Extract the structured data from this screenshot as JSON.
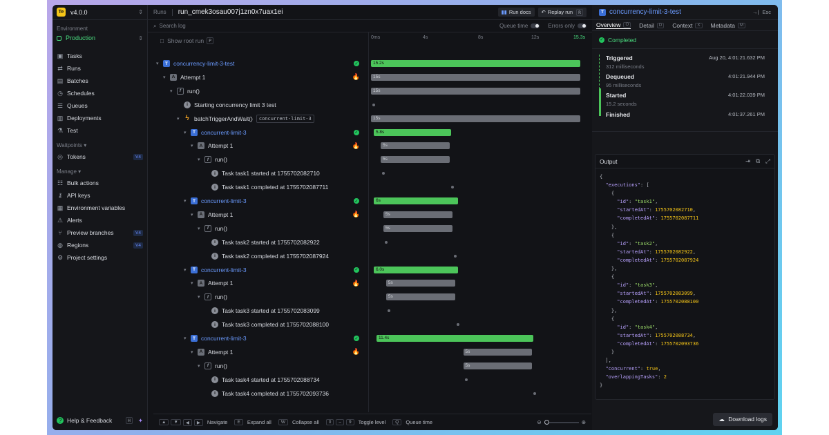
{
  "app": {
    "version": "v4.0.0",
    "logo": "Te"
  },
  "sidebar": {
    "env_label": "Environment",
    "env_value": "Production",
    "items": [
      {
        "label": "Tasks",
        "icon": "tasks-icon",
        "glyph": "▣"
      },
      {
        "label": "Runs",
        "icon": "runs-icon",
        "glyph": "⇄"
      },
      {
        "label": "Batches",
        "icon": "batches-icon",
        "glyph": "▤"
      },
      {
        "label": "Schedules",
        "icon": "schedules-icon",
        "glyph": "◷"
      },
      {
        "label": "Queues",
        "icon": "queues-icon",
        "glyph": "☰"
      },
      {
        "label": "Deployments",
        "icon": "deployments-icon",
        "glyph": "▥"
      },
      {
        "label": "Test",
        "icon": "test-icon",
        "glyph": "⚗"
      }
    ],
    "waitpoints_label": "Waitpoints ▾",
    "waitpoints": [
      {
        "label": "Tokens",
        "badge": "V4",
        "glyph": "◎"
      }
    ],
    "manage_label": "Manage ▾",
    "manage": [
      {
        "label": "Bulk actions",
        "badge": "",
        "glyph": "☷"
      },
      {
        "label": "API keys",
        "badge": "",
        "glyph": "⚷"
      },
      {
        "label": "Environment variables",
        "badge": "",
        "glyph": "▦"
      },
      {
        "label": "Alerts",
        "badge": "",
        "glyph": "⚠"
      },
      {
        "label": "Preview branches",
        "badge": "V4",
        "glyph": "⑂"
      },
      {
        "label": "Regions",
        "badge": "V4",
        "glyph": "◍"
      },
      {
        "label": "Project settings",
        "badge": "",
        "glyph": "⚙"
      }
    ],
    "help": "Help & Feedback",
    "help_kbd": "H"
  },
  "topbar": {
    "crumb": "Runs",
    "run_id": "run_cmek3osau007j1zn0x7uax1ei",
    "docs": "Run docs",
    "replay": "Replay run",
    "replay_kbd": "R"
  },
  "search": {
    "placeholder": "Search log",
    "queue_time": "Queue time",
    "errors_only": "Errors only"
  },
  "tree_header": {
    "show_root": "Show root run",
    "kbd": "P"
  },
  "ticks": [
    {
      "label": "0ms"
    },
    {
      "label": "4s"
    },
    {
      "label": "8s"
    },
    {
      "label": "12s"
    },
    {
      "label": "15.3s"
    }
  ],
  "rows": [
    {
      "depth": 0,
      "caret": "▾",
      "icon": "t",
      "label": "concurrency-limit-3-test",
      "blue": true,
      "status": "ok",
      "bar": {
        "kind": "g",
        "start": 0,
        "end": 15.2,
        "label": "15.2s"
      }
    },
    {
      "depth": 1,
      "caret": "▾",
      "icon": "a",
      "label": "Attempt 1",
      "status": "fire",
      "bar": {
        "kind": "s",
        "start": 0,
        "end": 15.2,
        "label": "15s"
      }
    },
    {
      "depth": 2,
      "caret": "▾",
      "icon": "f",
      "label": "run()",
      "bar": {
        "kind": "s",
        "start": 0,
        "end": 15.2,
        "label": "15s"
      }
    },
    {
      "depth": 3,
      "caret": "",
      "icon": "i",
      "label": "Starting concurrency limit 3 test",
      "dot": 0.1
    },
    {
      "depth": 3,
      "caret": "▾",
      "icon": "b",
      "label": "batchTriggerAndWait()",
      "tag": "concurrent-limit-3",
      "bar": {
        "kind": "s",
        "start": 0,
        "end": 15.2,
        "label": "15s"
      }
    },
    {
      "depth": 4,
      "caret": "▾",
      "icon": "t",
      "label": "concurrent-limit-3",
      "blue": true,
      "status": "ok",
      "bar": {
        "kind": "g",
        "start": 0.2,
        "end": 5.8,
        "label": "5.8s"
      }
    },
    {
      "depth": 5,
      "caret": "▾",
      "icon": "a",
      "label": "Attempt 1",
      "status": "fire",
      "bar": {
        "kind": "s",
        "start": 0.7,
        "end": 5.7,
        "label": "5s"
      }
    },
    {
      "depth": 6,
      "caret": "▾",
      "icon": "f",
      "label": "run()",
      "bar": {
        "kind": "s",
        "start": 0.7,
        "end": 5.7,
        "label": "5s"
      }
    },
    {
      "depth": 7,
      "caret": "",
      "icon": "i",
      "label": "Task task1 started at 1755702082710",
      "dot": 0.8
    },
    {
      "depth": 7,
      "caret": "",
      "icon": "i",
      "label": "Task task1 completed at 1755702087711",
      "dot": 5.8
    },
    {
      "depth": 4,
      "caret": "▾",
      "icon": "t",
      "label": "concurrent-limit-3",
      "blue": true,
      "status": "ok",
      "bar": {
        "kind": "g",
        "start": 0.2,
        "end": 6.3,
        "label": "6s"
      }
    },
    {
      "depth": 5,
      "caret": "▾",
      "icon": "a",
      "label": "Attempt 1",
      "status": "fire",
      "bar": {
        "kind": "s",
        "start": 0.9,
        "end": 5.9,
        "label": "5s"
      }
    },
    {
      "depth": 6,
      "caret": "▾",
      "icon": "f",
      "label": "run()",
      "bar": {
        "kind": "s",
        "start": 0.9,
        "end": 5.9,
        "label": "5s"
      }
    },
    {
      "depth": 7,
      "caret": "",
      "icon": "i",
      "label": "Task task2 started at 1755702082922",
      "dot": 1.0
    },
    {
      "depth": 7,
      "caret": "",
      "icon": "i",
      "label": "Task task2 completed at 1755702087924",
      "dot": 6.0
    },
    {
      "depth": 4,
      "caret": "▾",
      "icon": "t",
      "label": "concurrent-limit-3",
      "blue": true,
      "status": "ok",
      "bar": {
        "kind": "g",
        "start": 0.2,
        "end": 6.3,
        "label": "6.0s"
      }
    },
    {
      "depth": 5,
      "caret": "▾",
      "icon": "a",
      "label": "Attempt 1",
      "status": "fire",
      "bar": {
        "kind": "s",
        "start": 1.1,
        "end": 6.1,
        "label": "5s"
      }
    },
    {
      "depth": 6,
      "caret": "▾",
      "icon": "f",
      "label": "run()",
      "bar": {
        "kind": "s",
        "start": 1.1,
        "end": 6.1,
        "label": "5s"
      }
    },
    {
      "depth": 7,
      "caret": "",
      "icon": "i",
      "label": "Task task3 started at 1755702083099",
      "dot": 1.2
    },
    {
      "depth": 7,
      "caret": "",
      "icon": "i",
      "label": "Task task3 completed at 1755702088100",
      "dot": 6.2
    },
    {
      "depth": 4,
      "caret": "▾",
      "icon": "t",
      "label": "concurrent-limit-3",
      "blue": true,
      "status": "ok",
      "bar": {
        "kind": "g",
        "start": 0.4,
        "end": 11.8,
        "label": "11.4s"
      }
    },
    {
      "depth": 5,
      "caret": "▾",
      "icon": "a",
      "label": "Attempt 1",
      "status": "fire",
      "bar": {
        "kind": "s",
        "start": 6.7,
        "end": 11.7,
        "label": "5s"
      }
    },
    {
      "depth": 6,
      "caret": "▾",
      "icon": "f",
      "label": "run()",
      "bar": {
        "kind": "s",
        "start": 6.7,
        "end": 11.7,
        "label": "5s"
      }
    },
    {
      "depth": 7,
      "caret": "",
      "icon": "i",
      "label": "Task task4 started at 1755702088734",
      "dot": 6.8
    },
    {
      "depth": 7,
      "caret": "",
      "icon": "i",
      "label": "Task task4 completed at 1755702093736",
      "dot": 11.8
    }
  ],
  "bottombar": [
    {
      "keys": [
        "▲",
        "▼",
        "◀",
        "▶"
      ],
      "label": "Navigate"
    },
    {
      "keys": [
        "E"
      ],
      "label": "Expand all"
    },
    {
      "keys": [
        "W"
      ],
      "label": "Collapse all"
    },
    {
      "keys": [
        "0",
        "–",
        "9"
      ],
      "label": "Toggle level"
    },
    {
      "keys": [
        "Q"
      ],
      "label": "Queue time"
    }
  ],
  "panel": {
    "title": "concurrency-limit-3-test",
    "esc": "Esc",
    "tabs": [
      {
        "label": "Overview",
        "kbd": "O",
        "active": true
      },
      {
        "label": "Detail",
        "kbd": "D"
      },
      {
        "label": "Context",
        "kbd": "X"
      },
      {
        "label": "Metadata",
        "kbd": "M"
      }
    ],
    "status": "Completed",
    "timeline": [
      {
        "label": "Triggered",
        "sub": "312 milliseconds",
        "time": "Aug 20, 4:01:21.632 PM"
      },
      {
        "label": "Dequeued",
        "sub": "95 milliseconds",
        "time": "4:01:21.944 PM"
      },
      {
        "label": "Started",
        "sub": "15.2 seconds",
        "time": "4:01:22.039 PM"
      },
      {
        "label": "Finished",
        "sub": "",
        "time": "4:01:37.261 PM"
      }
    ],
    "output_label": "Output",
    "download": "Download logs"
  },
  "output": {
    "executions": [
      {
        "id": "task1",
        "startedAt": 1755702082710,
        "completedAt": 1755702087711
      },
      {
        "id": "task2",
        "startedAt": 1755702082922,
        "completedAt": 1755702087924
      },
      {
        "id": "task3",
        "startedAt": 1755702083099,
        "completedAt": 1755702088100
      },
      {
        "id": "task4",
        "startedAt": 1755702088734,
        "completedAt": 1755702093736
      }
    ],
    "concurrent": "true",
    "overlappingTasks": 2
  },
  "colors": {
    "accent_green": "#4cc55a",
    "blue": "#3b6fd6",
    "bar_gray": "#6a6d75"
  }
}
